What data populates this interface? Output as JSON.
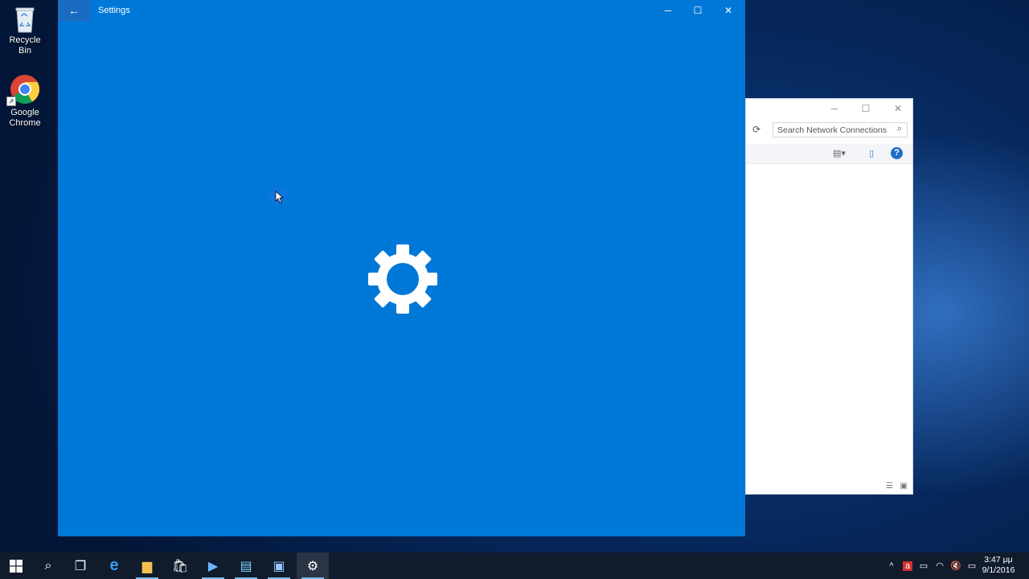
{
  "desktop": {
    "icons": [
      {
        "label": "Recycle Bin",
        "icon": "recycle-bin-icon"
      },
      {
        "label": "Google Chrome",
        "icon": "chrome-icon"
      }
    ]
  },
  "settings_window": {
    "title": "Settings",
    "back_icon": "back-arrow-icon",
    "loading_icon": "gear-icon",
    "accent": "#0078d7"
  },
  "network_window": {
    "search_placeholder": "Search Network Connections"
  },
  "taskbar": {
    "clock_time": "3:47 μμ",
    "clock_date": "9/1/2016",
    "color": "#101c2c"
  }
}
